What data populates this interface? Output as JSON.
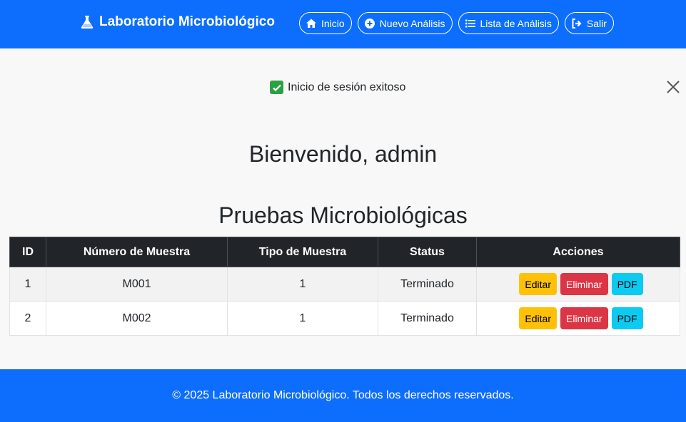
{
  "navbar": {
    "brand": "Laboratorio Microbiológico",
    "brand_icon": "flask-icon",
    "buttons": [
      {
        "label": "Inicio",
        "icon": "home-icon"
      },
      {
        "label": "Nuevo Análisis",
        "icon": "plus-circle-icon"
      },
      {
        "label": "Lista de Análisis",
        "icon": "list-icon"
      },
      {
        "label": "Salir",
        "icon": "logout-icon"
      }
    ]
  },
  "alert": {
    "text": "Inicio de sesión exitoso",
    "icon": "check-icon"
  },
  "welcome": "Bienvenido, admin",
  "section_title": "Pruebas Microbiológicas",
  "table": {
    "headers": [
      "ID",
      "Número de Muestra",
      "Tipo de Muestra",
      "Status",
      "Acciones"
    ],
    "rows": [
      {
        "id": "1",
        "numero": "M001",
        "tipo": "1",
        "status": "Terminado"
      },
      {
        "id": "2",
        "numero": "M002",
        "tipo": "1",
        "status": "Terminado"
      }
    ],
    "actions": {
      "edit": "Editar",
      "delete": "Eliminar",
      "pdf": "PDF"
    }
  },
  "footer": "© 2025 Laboratorio Microbiológico. Todos los derechos reservados.",
  "colors": {
    "primary": "#0d6efd",
    "dark": "#212529",
    "warning": "#ffc107",
    "danger": "#dc3545",
    "info": "#0dcaf0",
    "success": "#2ea043"
  }
}
